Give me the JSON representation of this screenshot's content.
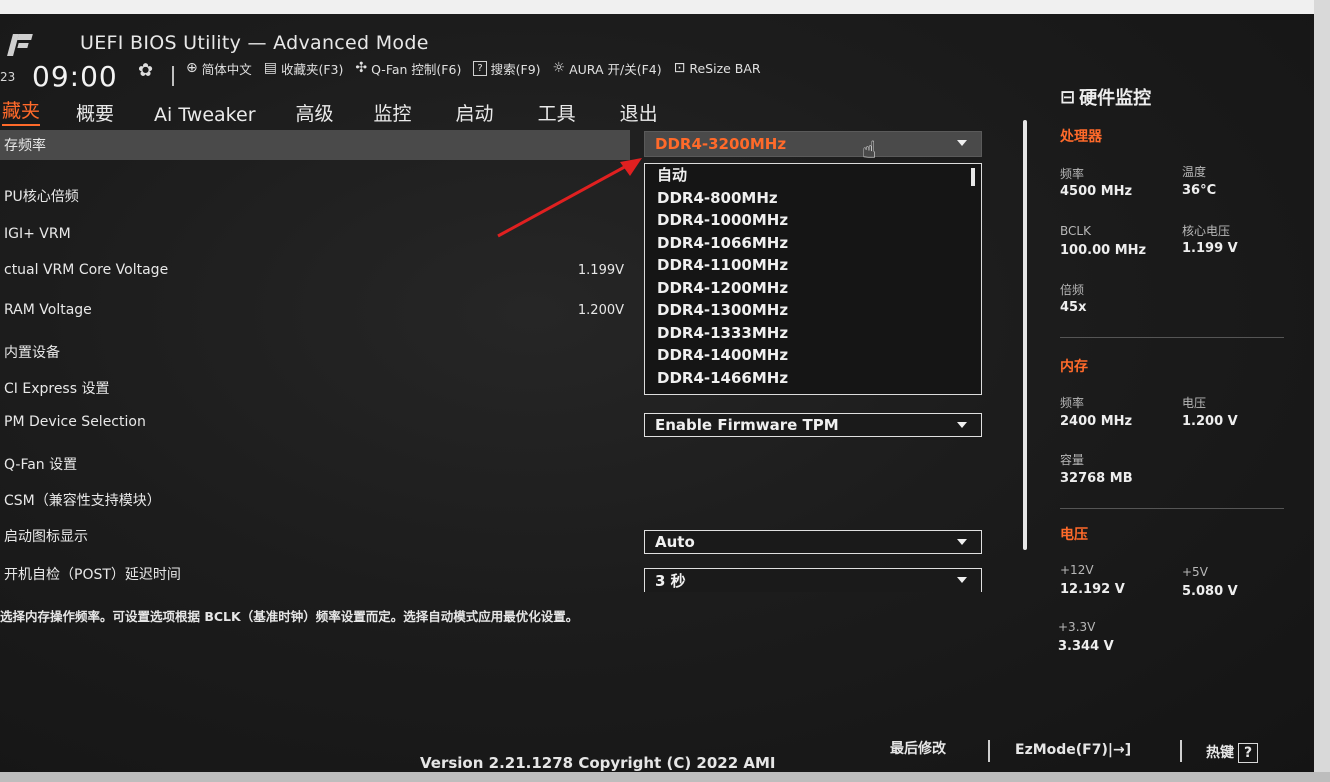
{
  "header": {
    "title": "UEFI BIOS Utility — Advanced Mode",
    "year_fragment": "23",
    "time": "09:00",
    "toolbar": [
      {
        "icon": "globe-icon",
        "glyph": "⊕",
        "label": "简体中文"
      },
      {
        "icon": "favorites-icon",
        "glyph": "▤",
        "label": "收藏夹(F3)"
      },
      {
        "icon": "fan-icon",
        "glyph": "⚘",
        "label": "Q-Fan 控制(F6)"
      },
      {
        "icon": "search-icon",
        "glyph": "?",
        "label": "搜索(F9)"
      },
      {
        "icon": "aura-icon",
        "glyph": "☼",
        "label": "AURA 开/关(F4)"
      },
      {
        "icon": "resize-bar-icon",
        "glyph": "⊡",
        "label": "ReSize BAR"
      }
    ]
  },
  "tabs": [
    "藏夹",
    "概要",
    "Ai Tweaker",
    "高级",
    "监控",
    "启动",
    "工具",
    "退出"
  ],
  "menu": [
    {
      "label": "存频率",
      "value": ""
    },
    {
      "label": "PU核心倍频",
      "value": ""
    },
    {
      "label": "IGI+ VRM",
      "value": ""
    },
    {
      "label": "ctual VRM Core Voltage",
      "value": "1.199V"
    },
    {
      "label": "RAM Voltage",
      "value": "1.200V"
    },
    {
      "label": "内置设备",
      "value": ""
    },
    {
      "label": "CI Express 设置",
      "value": ""
    },
    {
      "label": "PM Device Selection",
      "value": ""
    },
    {
      "label": "Q-Fan 设置",
      "value": ""
    },
    {
      "label": "CSM（兼容性支持模块）",
      "value": ""
    },
    {
      "label": "启动图标显示",
      "value": ""
    },
    {
      "label": " 开机自检（POST）延迟时间",
      "value": ""
    }
  ],
  "dropdowns": {
    "memory_freq": "DDR4-3200MHz",
    "tpm": "Enable Firmware TPM",
    "boot_logo": "Auto",
    "post_delay": "3 秒"
  },
  "dropdown_options": [
    "自动",
    "DDR4-800MHz",
    "DDR4-1000MHz",
    "DDR4-1066MHz",
    "DDR4-1100MHz",
    "DDR4-1200MHz",
    "DDR4-1300MHz",
    "DDR4-1333MHz",
    "DDR4-1400MHz",
    "DDR4-1466MHz"
  ],
  "help_text": "选择内存操作频率。可设置选项根据 BCLK（基准时钟）频率设置而定。选择自动模式应用最优化设置。",
  "hardware_monitor": {
    "title": "硬件监控",
    "cpu": {
      "heading": "处理器",
      "freq_label": "频率",
      "freq": "4500 MHz",
      "temp_label": "温度",
      "temp": "36°C",
      "bclk_label": "BCLK",
      "bclk": "100.00 MHz",
      "vcore_label": "核心电压",
      "vcore": "1.199 V",
      "ratio_label": "倍频",
      "ratio": "45x"
    },
    "memory": {
      "heading": "内存",
      "freq_label": "频率",
      "freq": "2400 MHz",
      "volt_label": "电压",
      "volt": "1.200 V",
      "cap_label": "容量",
      "cap": "32768 MB"
    },
    "voltage": {
      "heading": "电压",
      "v12_label": "+12V",
      "v12": "12.192 V",
      "v5_label": "+5V",
      "v5": "5.080 V",
      "v33_label": "+3.3V",
      "v33": "3.344 V"
    }
  },
  "footer": {
    "version": "Version 2.21.1278 Copyright (C) 2022 AMI",
    "last_modified": "最后修改",
    "ezmode": "EzMode(F7)|→]",
    "hotkeys": "热键",
    "hotkeys_box": "?"
  },
  "colors": {
    "accent": "#ff6a2a",
    "background": "#1c1c1c",
    "highlight": "#4a4a4a"
  }
}
